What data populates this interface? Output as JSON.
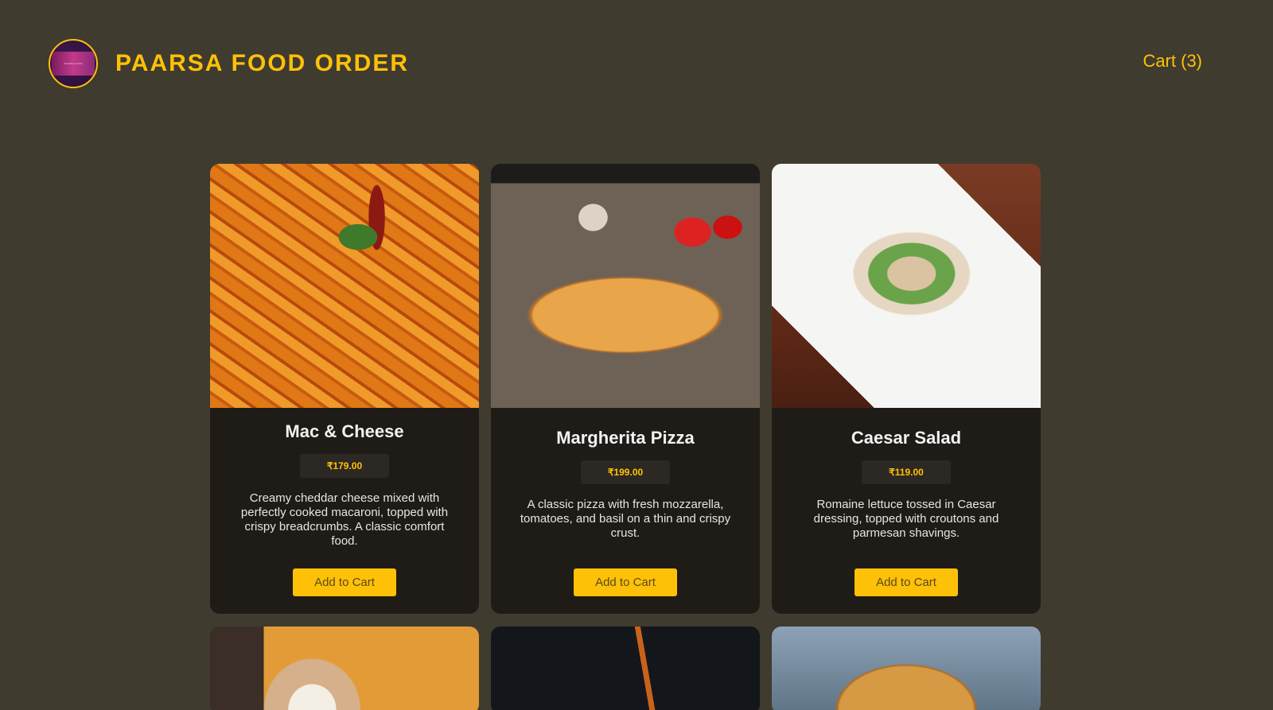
{
  "header": {
    "logo_text": "PAARSA FOOD",
    "brand": "PAARSA FOOD ORDER",
    "cart_label": "Cart (3)"
  },
  "colors": {
    "accent": "#ffc107",
    "background": "#3f3b2f",
    "card": "#1f1b17"
  },
  "menu": [
    {
      "name": "Mac & Cheese",
      "price": "₹179.00",
      "description": "Creamy cheddar cheese mixed with perfectly cooked macaroni, topped with crispy breadcrumbs. A classic comfort food.",
      "button": "Add to Cart"
    },
    {
      "name": "Margherita Pizza",
      "price": "₹199.00",
      "description": "A classic pizza with fresh mozzarella, tomatoes, and basil on a thin and crispy crust.",
      "button": "Add to Cart"
    },
    {
      "name": "Caesar Salad",
      "price": "₹119.00",
      "description": "Romaine lettuce tossed in Caesar dressing, topped with croutons and parmesan shavings.",
      "button": "Add to Cart"
    }
  ]
}
